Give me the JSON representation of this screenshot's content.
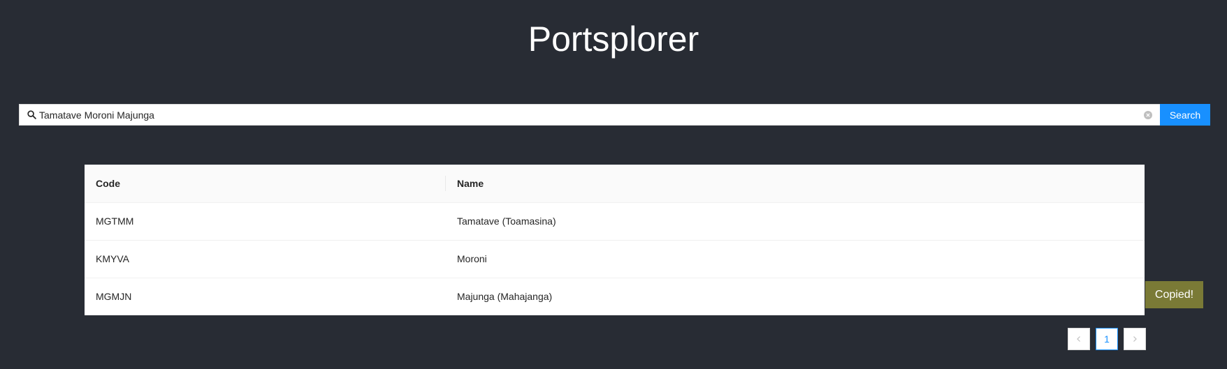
{
  "app": {
    "title": "Portsplorer"
  },
  "search": {
    "value": "Tamatave Moroni Majunga",
    "button_label": "Search",
    "icon": "search-icon",
    "clear_icon": "clear-icon"
  },
  "table": {
    "columns": [
      "Code",
      "Name"
    ],
    "rows": [
      {
        "code": "MGTMM",
        "name": "Tamatave (Toamasina)"
      },
      {
        "code": "KMYVA",
        "name": "Moroni"
      },
      {
        "code": "MGMJN",
        "name": "Majunga (Mahajanga)"
      }
    ]
  },
  "toast": {
    "text": "Copied!"
  },
  "pagination": {
    "prev_label": "<",
    "current": "1",
    "next_label": ">"
  },
  "colors": {
    "background": "#282c34",
    "accent": "#1890ff",
    "toast": "#7a7a36"
  }
}
